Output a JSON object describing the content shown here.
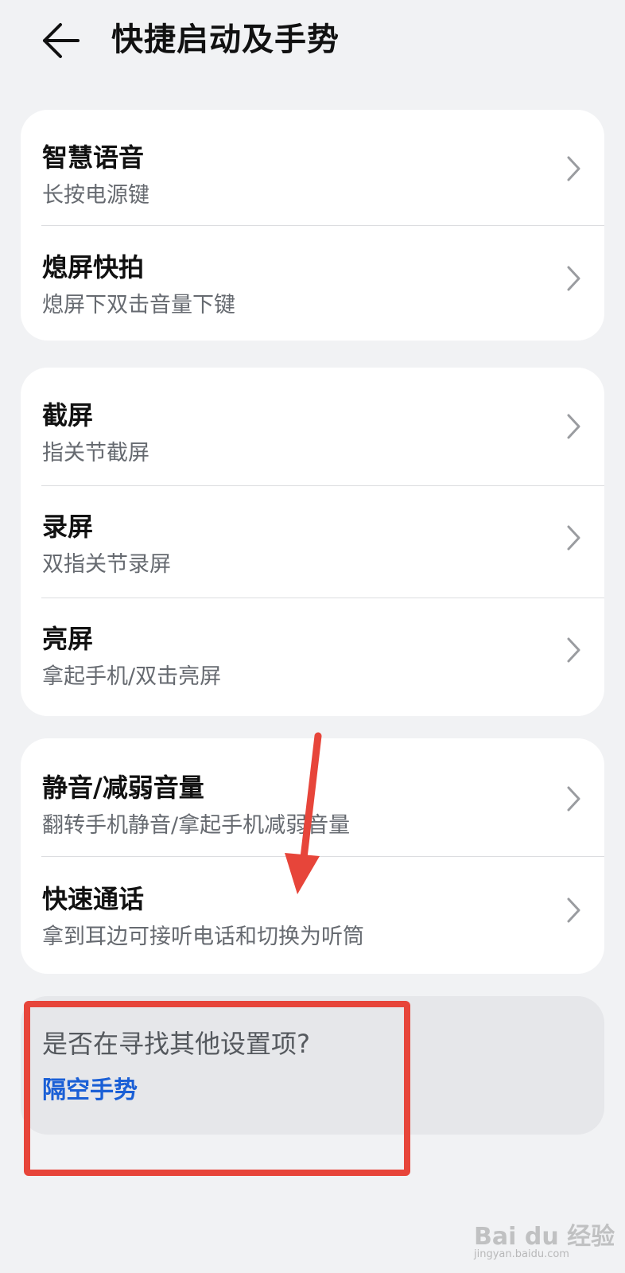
{
  "header": {
    "title": "快捷启动及手势",
    "back_icon": "arrow-left-icon"
  },
  "groups": [
    {
      "items": [
        {
          "title": "智慧语音",
          "subtitle": "长按电源键"
        },
        {
          "title": "熄屏快拍",
          "subtitle": "熄屏下双击音量下键"
        }
      ]
    },
    {
      "items": [
        {
          "title": "截屏",
          "subtitle": "指关节截屏"
        },
        {
          "title": "录屏",
          "subtitle": "双指关节录屏"
        },
        {
          "title": "亮屏",
          "subtitle": "拿起手机/双击亮屏"
        }
      ]
    },
    {
      "items": [
        {
          "title": "静音/减弱音量",
          "subtitle": "翻转手机静音/拿起手机减弱音量"
        },
        {
          "title": "快速通话",
          "subtitle": "拿到耳边可接听电话和切换为听筒"
        }
      ]
    }
  ],
  "suggestion": {
    "question": "是否在寻找其他设置项?",
    "link": "隔空手势"
  },
  "annotation": {
    "color": "#e7453a"
  },
  "watermark": {
    "text": "Bai du 经验",
    "sub": "jingyan.baidu.com"
  },
  "colors": {
    "background": "#f1f2f4",
    "card": "#ffffff",
    "link": "#1a5fd6",
    "annotation": "#e7453a"
  }
}
